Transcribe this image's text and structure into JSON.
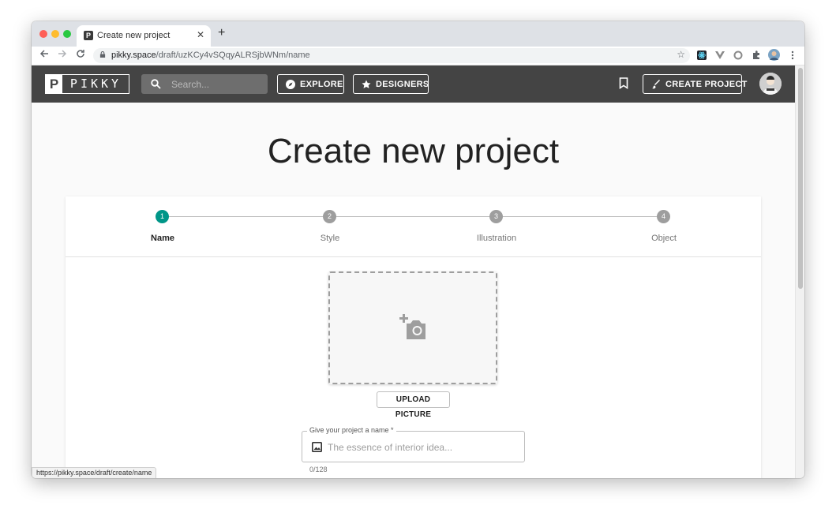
{
  "browser": {
    "tab_title": "Create new project",
    "tab_favicon": "P",
    "new_tab_symbol": "+",
    "close_symbol": "✕",
    "url_host": "pikky.space",
    "url_path": "/draft/uzKCy4vSQqyALRSjbWNm/name",
    "status_url": "https://pikky.space/draft/create/name",
    "icons": [
      "back-icon",
      "forward-icon",
      "reload-icon",
      "lock-icon",
      "star-icon",
      "react-devtools-icon",
      "vue-devtools-icon",
      "extension-circle-icon",
      "extensions-puzzle-icon",
      "profile-avatar-icon",
      "more-menu-icon"
    ]
  },
  "header": {
    "logo_letter": "P",
    "logo_text": "PIKKY",
    "search_placeholder": "Search...",
    "explore_label": "EXPLORE",
    "designers_label": "DESIGNERS",
    "create_project_label": "CREATE PROJECT",
    "colors": {
      "background": "#444444",
      "search_bg": "#6e6e6e"
    }
  },
  "main": {
    "title": "Create new project",
    "steps": [
      {
        "number": "1",
        "label": "Name",
        "active": true
      },
      {
        "number": "2",
        "label": "Style",
        "active": false
      },
      {
        "number": "3",
        "label": "Illustration",
        "active": false
      },
      {
        "number": "4",
        "label": "Object",
        "active": false
      }
    ],
    "upload_button": "UPLOAD PICTURE",
    "name_field": {
      "label": "Give your project a name *",
      "placeholder": "The essence of interior idea...",
      "value": "",
      "counter": "0/128"
    },
    "colors": {
      "active_step": "#009688",
      "inactive_step": "#9e9e9e"
    }
  }
}
